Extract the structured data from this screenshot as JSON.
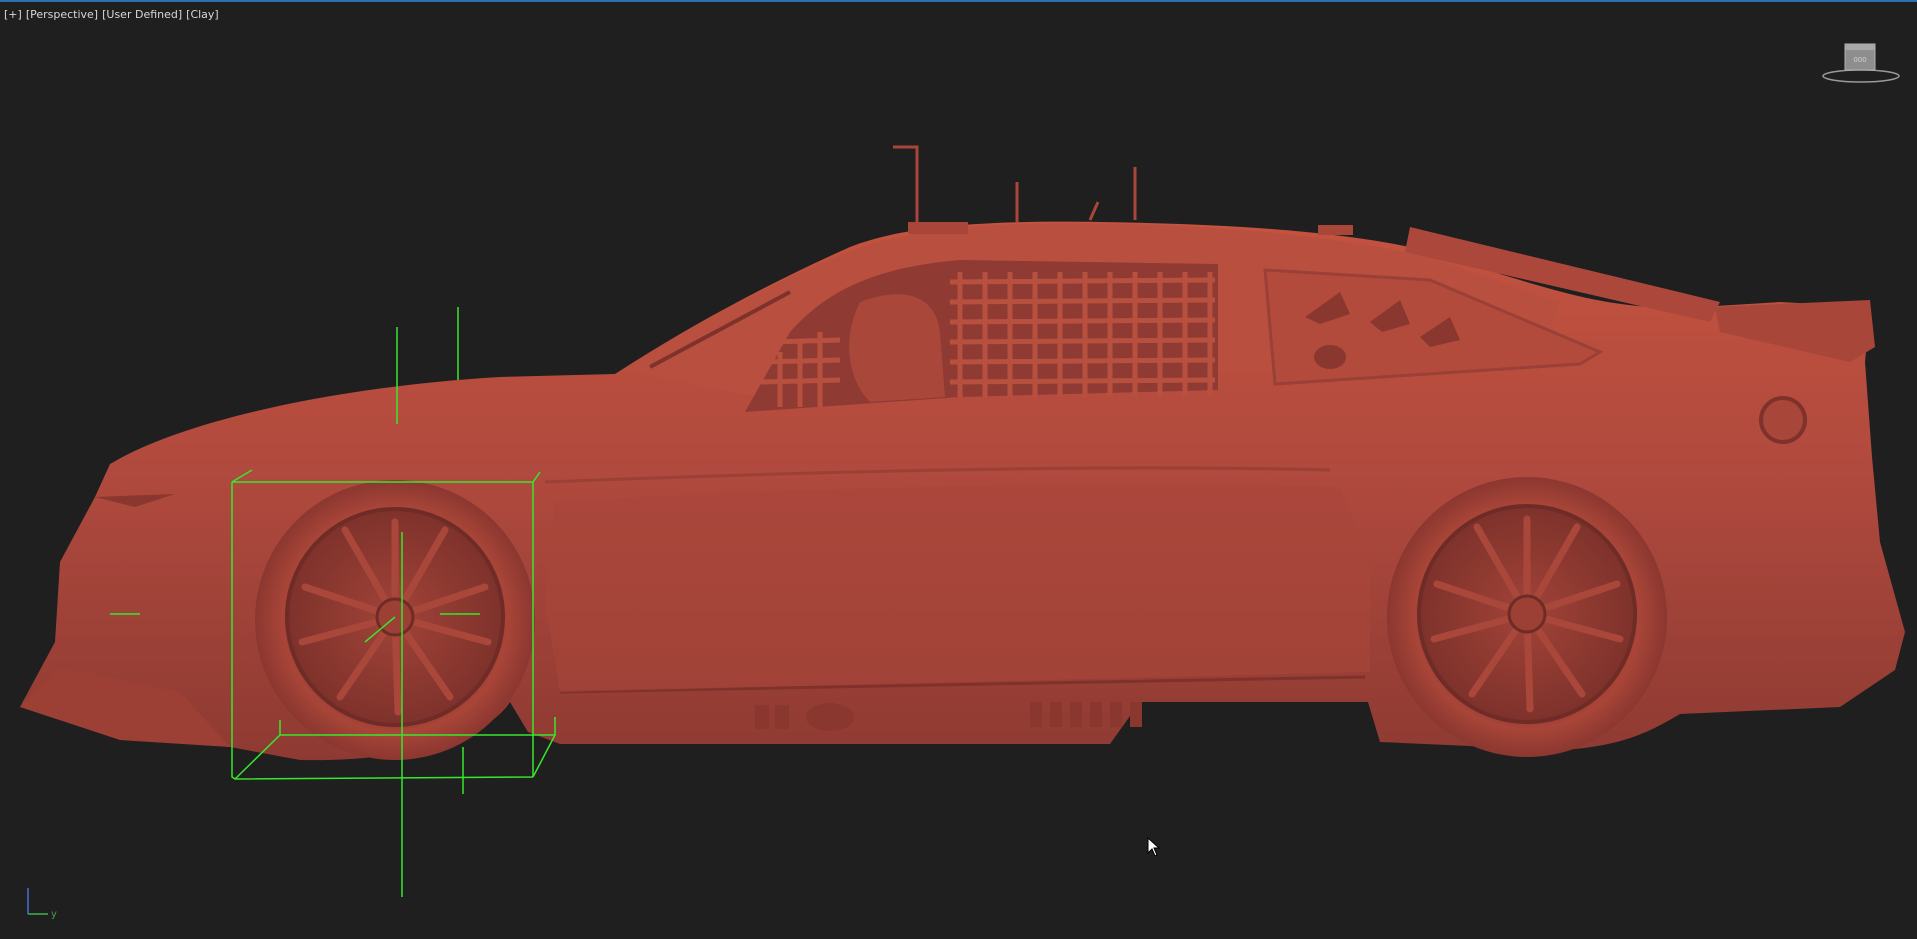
{
  "viewport": {
    "labels": [
      "[+]",
      "[Perspective]",
      "[User Defined]",
      "[Clay]"
    ],
    "background_color": "#1f1f1f",
    "active_border_color": "#2f6fb0"
  },
  "viewcube": {
    "icon": "viewcube-icon"
  },
  "scene": {
    "object": "race-car-clay-model",
    "clay_color": "#b64a3c",
    "selection_color": "#39e62e"
  },
  "axis_tripod": {
    "axis_label": "y"
  },
  "cursor": {
    "icon": "mouse-pointer-icon"
  }
}
